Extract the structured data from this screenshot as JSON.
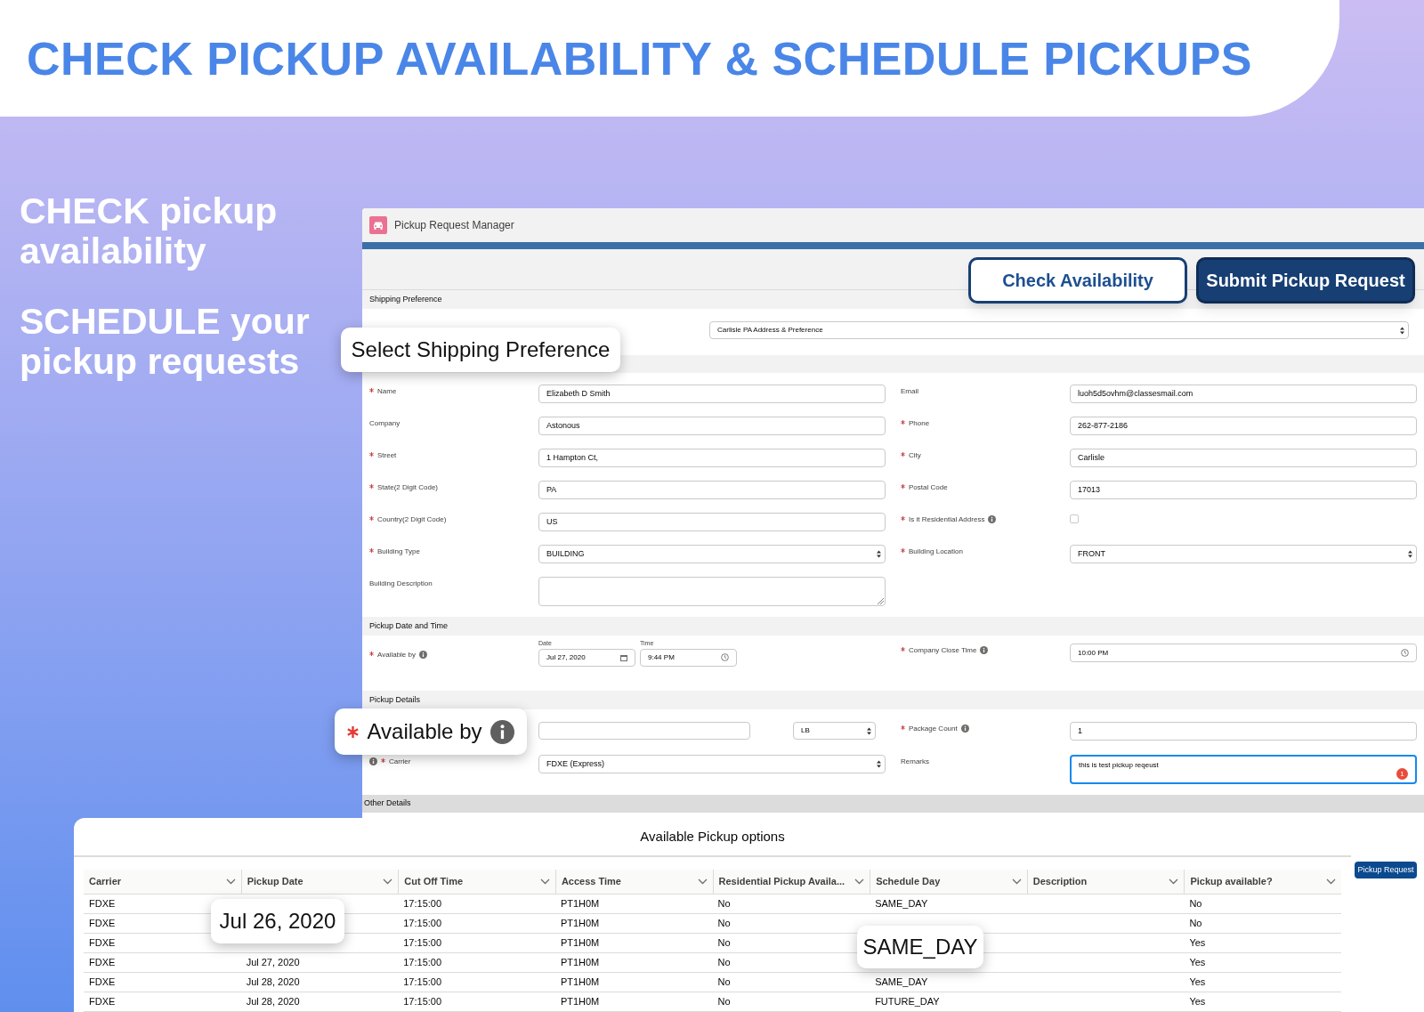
{
  "banner": {
    "title": "CHECK PICKUP AVAILABILITY & SCHEDULE PICKUPS"
  },
  "taglines": [
    "CHECK pickup availability",
    "SCHEDULE your pickup requests"
  ],
  "app": {
    "title": "Pickup Request Manager",
    "buttons": [
      {
        "label": "Check Availability",
        "kind": "outline"
      },
      {
        "label": "Submit Pickup Request",
        "kind": "solid"
      }
    ],
    "shipping_preference": {
      "heading": "Shipping Preference",
      "value": "Carlisle PA Address & Preference"
    },
    "fields": [
      {
        "label": "Name",
        "required": true,
        "kind": "text",
        "value": "Elizabeth D Smith"
      },
      {
        "label": "Email",
        "required": false,
        "kind": "text",
        "value": "luoh5d5ovhm@classesmail.com"
      },
      {
        "label": "Company",
        "required": false,
        "kind": "text",
        "value": "Astonous"
      },
      {
        "label": "Phone",
        "required": true,
        "kind": "text",
        "value": "262-877-2186"
      },
      {
        "label": "Street",
        "required": true,
        "kind": "text",
        "value": "1 Hampton Ct,"
      },
      {
        "label": "City",
        "required": true,
        "kind": "text",
        "value": "Carlisle"
      },
      {
        "label": "State(2 Digit Code)",
        "required": true,
        "kind": "text",
        "value": "PA"
      },
      {
        "label": "Postal Code",
        "required": true,
        "kind": "text",
        "value": "17013"
      },
      {
        "label": "Country(2 Digit Code)",
        "required": true,
        "kind": "text",
        "value": "US"
      },
      {
        "label": "Is it Residential Address",
        "required": true,
        "info": true,
        "kind": "checkbox",
        "checked": false
      },
      {
        "label": "Building Type",
        "required": true,
        "kind": "select",
        "value": "BUILDING"
      },
      {
        "label": "Building Location",
        "required": true,
        "kind": "select",
        "value": "FRONT"
      },
      {
        "label": "Building Description",
        "required": false,
        "kind": "textarea"
      }
    ],
    "pickup_date_time": {
      "heading": "Pickup Date and Time",
      "available_by": {
        "label": "Available by",
        "required": true,
        "date_label": "Date",
        "date": "Jul 27, 2020",
        "time_label": "Time",
        "time": "9:44 PM"
      },
      "close_time": {
        "label": "Company Close Time",
        "required": true,
        "value": "10:00 PM"
      }
    },
    "pickup_details": {
      "heading": "Pickup Details",
      "unit": "LB",
      "package_count": {
        "label": "Package Count",
        "required": true,
        "value": "1"
      },
      "carrier": {
        "label": "Carrier",
        "required": true,
        "value": "FDXE (Express)"
      },
      "remarks": {
        "label": "Remarks",
        "value": "this is test pickup reqeust",
        "badge": "1"
      }
    },
    "other_details": {
      "heading": "Other Details",
      "button": "Pickup Request"
    }
  },
  "callouts": [
    {
      "text": "Select Shipping Preference"
    },
    {
      "text": "Available by",
      "required": true
    },
    {
      "text": "Jul 26, 2020"
    },
    {
      "text": "SAME_DAY"
    }
  ],
  "options_table": {
    "title": "Available Pickup options",
    "columns": [
      "Carrier",
      "Pickup Date",
      "Cut Off Time",
      "Access Time",
      "Residential Pickup Availa...",
      "Schedule Day",
      "Description",
      "Pickup available?"
    ],
    "rows": [
      [
        "FDXE",
        null,
        "17:15:00",
        "PT1H0M",
        "No",
        "SAME_DAY",
        null,
        "No"
      ],
      [
        "FDXE",
        null,
        "17:15:00",
        "PT1H0M",
        "No",
        null,
        null,
        "No"
      ],
      [
        "FDXE",
        null,
        "17:15:00",
        "PT1H0M",
        "No",
        null,
        null,
        "Yes"
      ],
      [
        "FDXE",
        "Jul 27, 2020",
        "17:15:00",
        "PT1H0M",
        "No",
        null,
        null,
        "Yes"
      ],
      [
        "FDXE",
        "Jul 28, 2020",
        "17:15:00",
        "PT1H0M",
        "No",
        "SAME_DAY",
        null,
        "Yes"
      ],
      [
        "FDXE",
        "Jul 28, 2020",
        "17:15:00",
        "PT1H0M",
        "No",
        "FUTURE_DAY",
        null,
        "Yes"
      ]
    ]
  }
}
